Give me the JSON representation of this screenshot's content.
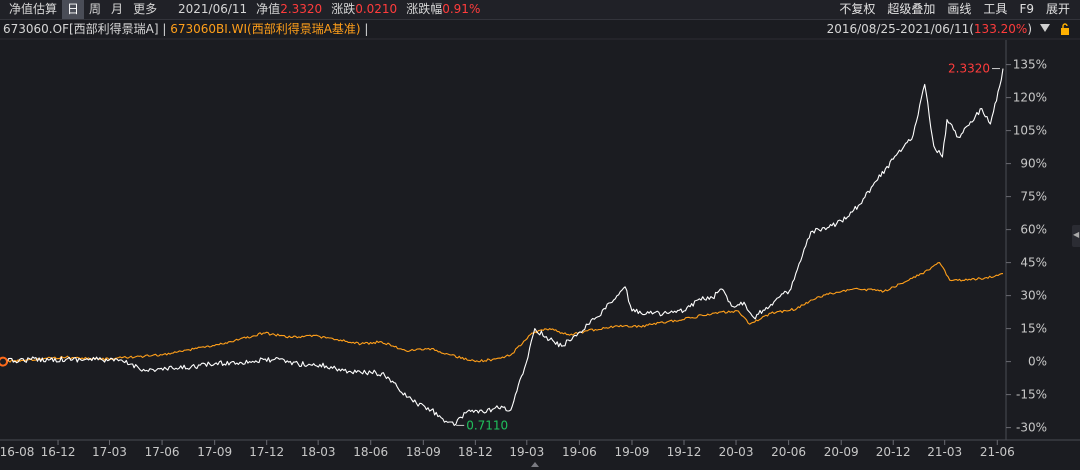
{
  "toolbar": {
    "title": "净值估算",
    "tabs": [
      {
        "label": "日",
        "active": true
      },
      {
        "label": "周",
        "active": false
      },
      {
        "label": "月",
        "active": false
      },
      {
        "label": "更多",
        "active": false
      }
    ],
    "date": "2021/06/11",
    "nav_label": "净值",
    "nav_value": "2.3320",
    "change_label": "涨跌",
    "change_value": "0.0210",
    "pct_label": "涨跌幅",
    "pct_value": "0.91%",
    "right_buttons": [
      "不复权",
      "超级叠加",
      "画线",
      "工具",
      "F9",
      "展开"
    ]
  },
  "legend": {
    "fund": "673060.OF[西部利得景瑞A]",
    "sep": " | ",
    "benchmark": "673060BI.WI(西部利得景瑞A基准)",
    "tail": " |",
    "range_label": "2016/08/25-2021/06/11(",
    "range_value": "133.20%",
    "range_close": ")"
  },
  "colors": {
    "background": "#1b1c21",
    "fund_line": "#ffffff",
    "benchmark_line": "#ff9f1a",
    "up": "#ff3c3c",
    "down": "#20c05c",
    "axis_text": "#c8c8c8"
  },
  "chart_data": {
    "type": "line",
    "x_ticks": [
      "16-08",
      "16-12",
      "17-03",
      "17-06",
      "17-09",
      "17-12",
      "18-03",
      "18-06",
      "18-09",
      "18-12",
      "19-03",
      "19-06",
      "19-09",
      "19-12",
      "20-03",
      "20-06",
      "20-09",
      "20-12",
      "21-03",
      "21-06"
    ],
    "y_ticks": [
      "135%",
      "120%",
      "105%",
      "90%",
      "75%",
      "60%",
      "45%",
      "30%",
      "15%",
      "0%",
      "-15%",
      "-30%"
    ],
    "ylim": [
      -32,
      138
    ],
    "annotations": [
      {
        "label": "2.3320",
        "series": "673060.OF",
        "kind": "max"
      },
      {
        "label": "0.7110",
        "series": "673060.OF",
        "kind": "min"
      }
    ],
    "series": [
      {
        "name": "673060.OF[西部利得景瑞A]",
        "color": "#ffffff",
        "x": [
          "2016-08-25",
          "2016-10-15",
          "2016-12-15",
          "2017-02-15",
          "2017-03-25",
          "2017-05-05",
          "2017-07-01",
          "2017-09-01",
          "2017-11-01",
          "2017-12-15",
          "2018-01-25",
          "2018-03-15",
          "2018-04-15",
          "2018-05-15",
          "2018-06-10",
          "2018-07-01",
          "2018-07-25",
          "2018-08-20",
          "2018-09-15",
          "2018-10-05",
          "2018-10-25",
          "2018-11-20",
          "2018-12-20",
          "2019-01-05",
          "2019-02-01",
          "2019-02-25",
          "2019-03-15",
          "2019-04-10",
          "2019-05-01",
          "2019-05-30",
          "2019-06-30",
          "2019-07-31",
          "2019-08-20",
          "2019-09-01",
          "2019-10-01",
          "2019-11-01",
          "2019-12-01",
          "2019-12-25",
          "2020-01-20",
          "2020-02-05",
          "2020-02-25",
          "2020-03-15",
          "2020-04-01",
          "2020-05-01",
          "2020-06-05",
          "2020-06-25",
          "2020-07-10",
          "2020-08-05",
          "2020-09-01",
          "2020-10-01",
          "2020-11-01",
          "2020-12-01",
          "2021-01-05",
          "2021-01-25",
          "2021-02-10",
          "2021-02-25",
          "2021-03-05",
          "2021-03-25",
          "2021-04-15",
          "2021-05-05",
          "2021-05-20",
          "2021-06-05",
          "2021-06-11"
        ],
        "y": [
          0,
          1,
          1,
          1,
          0,
          -4,
          -3,
          -1,
          0,
          1,
          -1,
          -2,
          -4,
          -5,
          -5,
          -7,
          -14,
          -19,
          -22,
          -26,
          -29,
          -22,
          -23,
          -21,
          -22,
          -3,
          15,
          10,
          7,
          13,
          20,
          28,
          34,
          23,
          22,
          22,
          23,
          28,
          29,
          33,
          25,
          27,
          20,
          26,
          33,
          48,
          59,
          60,
          64,
          71,
          82,
          92,
          103,
          126,
          98,
          93,
          110,
          102,
          109,
          115,
          108,
          125,
          133.2
        ]
      },
      {
        "name": "673060BI.WI(西部利得景瑞A基准)",
        "color": "#ff9f1a",
        "x": [
          "2016-08-25",
          "2016-10-15",
          "2016-12-15",
          "2017-02-15",
          "2017-04-05",
          "2017-06-01",
          "2017-08-01",
          "2017-10-01",
          "2017-11-25",
          "2018-01-15",
          "2018-02-15",
          "2018-04-01",
          "2018-05-15",
          "2018-06-20",
          "2018-08-01",
          "2018-09-10",
          "2018-10-20",
          "2018-12-01",
          "2018-12-31",
          "2019-02-01",
          "2019-03-10",
          "2019-04-10",
          "2019-05-15",
          "2019-06-15",
          "2019-08-01",
          "2019-09-15",
          "2019-11-01",
          "2019-12-15",
          "2020-01-20",
          "2020-03-05",
          "2020-03-25",
          "2020-05-01",
          "2020-06-15",
          "2020-07-10",
          "2020-08-15",
          "2020-10-01",
          "2020-11-15",
          "2020-12-20",
          "2021-01-20",
          "2021-02-20",
          "2021-03-10",
          "2021-04-10",
          "2021-05-10",
          "2021-06-11"
        ],
        "y": [
          0,
          1,
          2,
          1,
          2,
          3,
          6,
          9,
          13,
          11,
          12,
          10,
          8,
          9,
          5,
          6,
          3,
          0,
          1,
          3,
          13,
          15,
          12,
          14,
          16,
          16,
          18,
          20,
          22,
          23,
          17,
          22,
          24,
          28,
          31,
          33,
          32,
          36,
          40,
          45,
          37,
          37,
          38,
          40
        ]
      }
    ]
  }
}
